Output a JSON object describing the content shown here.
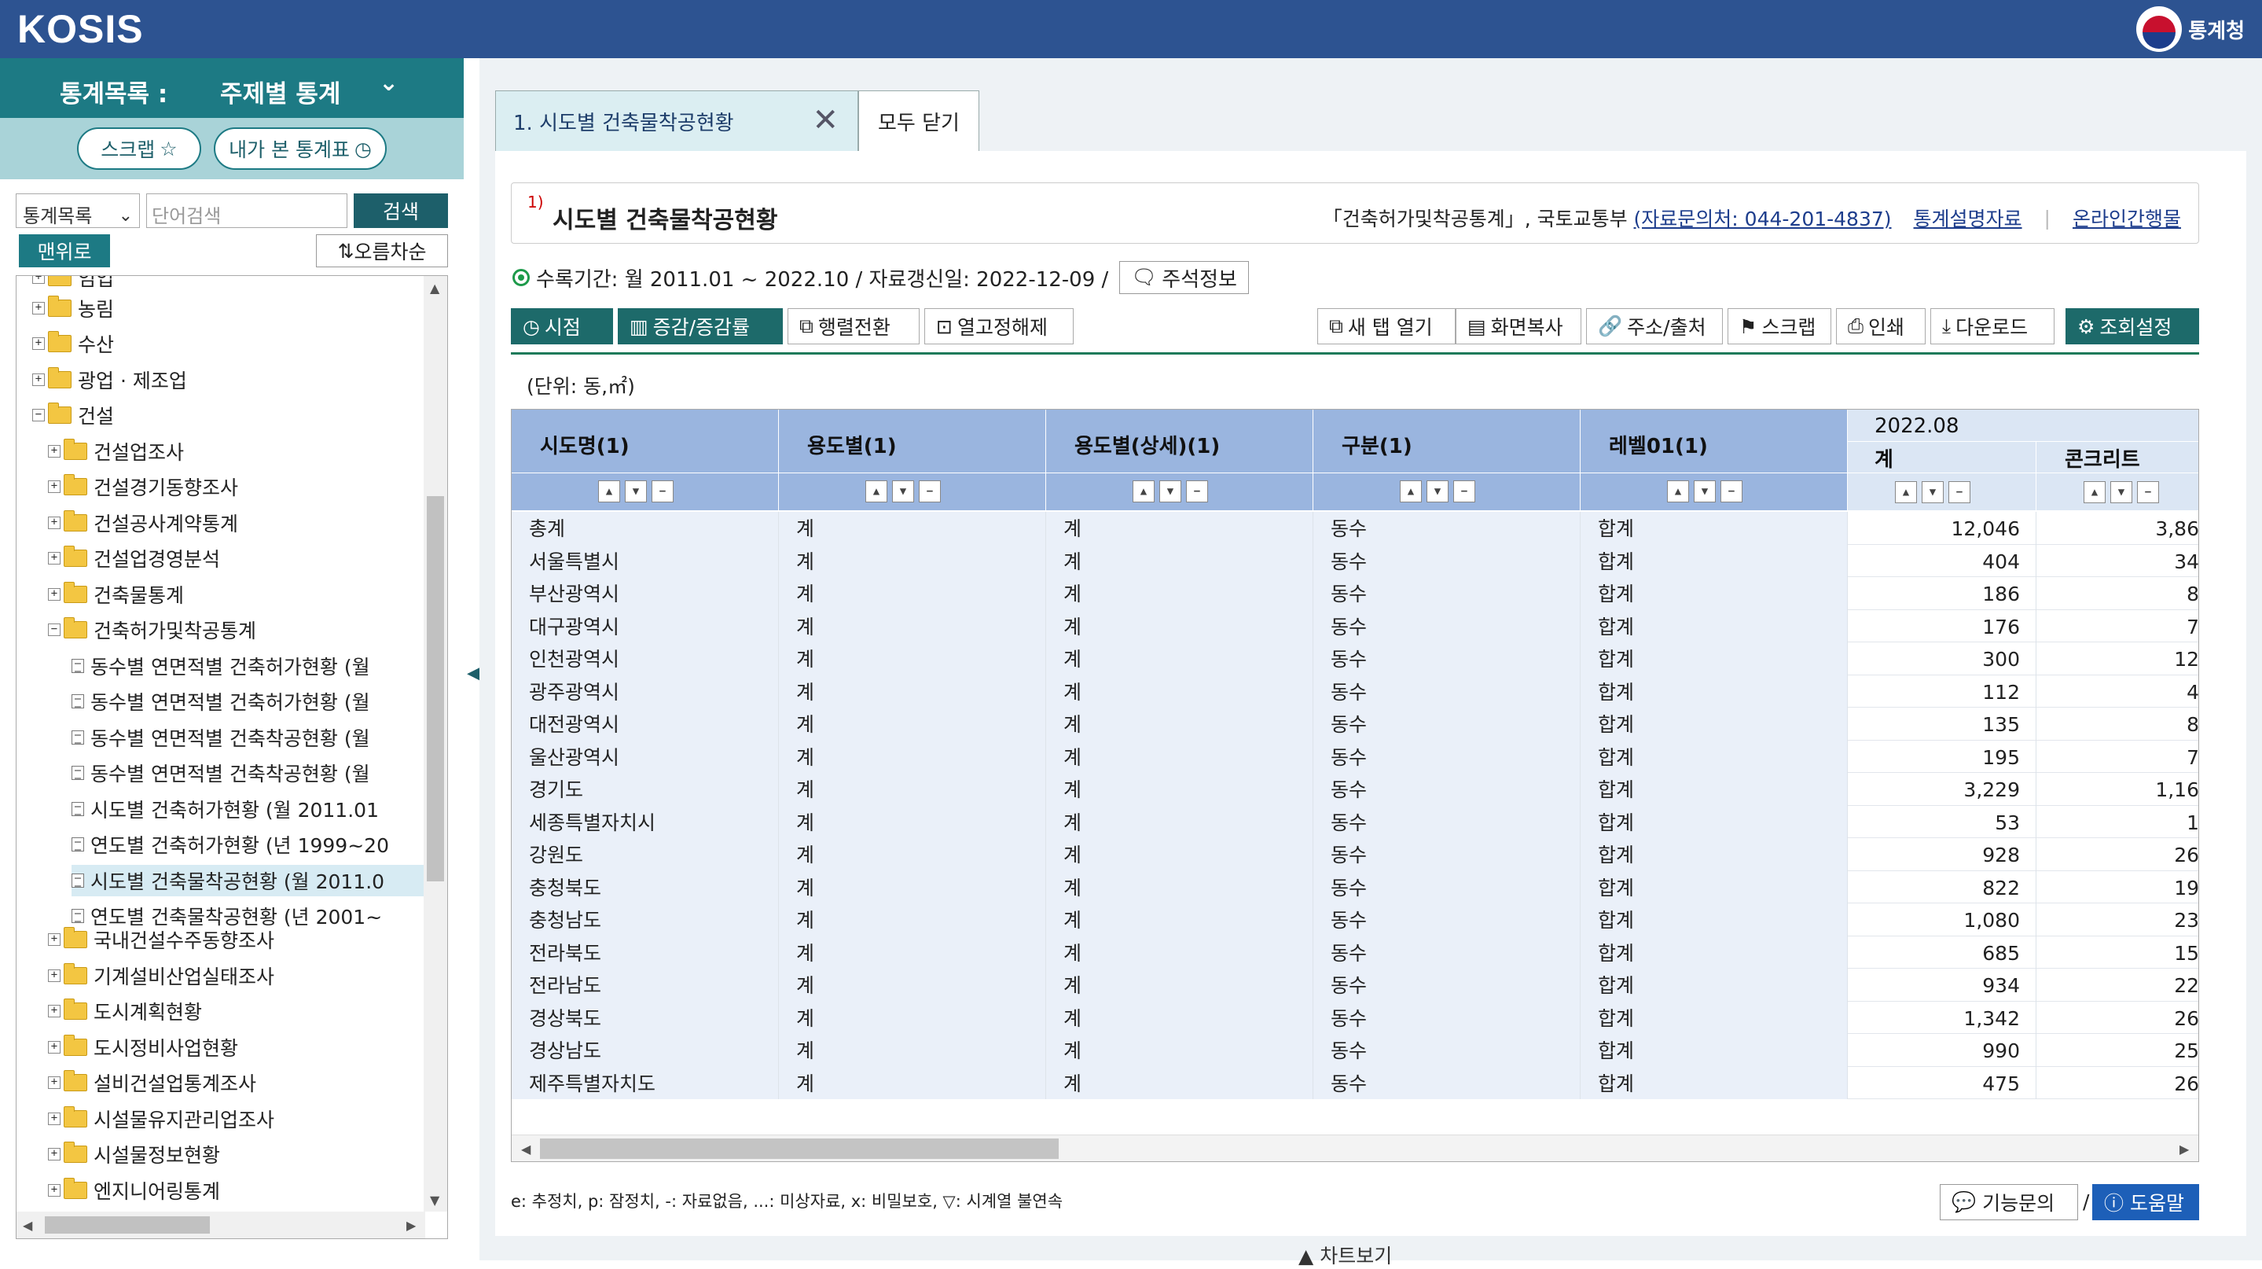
{
  "header": {
    "logo": "KOSIS",
    "agency": "통계청"
  },
  "sidebar": {
    "title": "통계목록 :",
    "mode": "주제별 통계",
    "scrap": "스크랩",
    "my_tables": "내가 본 통계표",
    "search_select": "통계목록",
    "search_placeholder": "단어검색",
    "search_btn": "검색",
    "top_btn": "맨위로",
    "sort_btn": "오름차순",
    "tree": [
      {
        "label": "임업",
        "level": 1,
        "type": "folder",
        "exp": "+"
      },
      {
        "label": "농림",
        "level": 1,
        "type": "folder",
        "exp": "+"
      },
      {
        "label": "수산",
        "level": 1,
        "type": "folder",
        "exp": "+"
      },
      {
        "label": "광업 · 제조업",
        "level": 1,
        "type": "folder",
        "exp": "+"
      },
      {
        "label": "건설",
        "level": 1,
        "type": "folder",
        "exp": "-"
      },
      {
        "label": "건설업조사",
        "level": 2,
        "type": "folder",
        "exp": "+"
      },
      {
        "label": "건설경기동향조사",
        "level": 2,
        "type": "folder",
        "exp": "+"
      },
      {
        "label": "건설공사계약통계",
        "level": 2,
        "type": "folder",
        "exp": "+"
      },
      {
        "label": "건설업경영분석",
        "level": 2,
        "type": "folder",
        "exp": "+"
      },
      {
        "label": "건축물통계",
        "level": 2,
        "type": "folder",
        "exp": "+"
      },
      {
        "label": "건축허가및착공통계",
        "level": 2,
        "type": "folder",
        "exp": "-"
      },
      {
        "label": "동수별 연면적별 건축허가현황 (월",
        "level": 3,
        "type": "doc"
      },
      {
        "label": "동수별 연면적별 건축허가현황 (월",
        "level": 3,
        "type": "doc"
      },
      {
        "label": "동수별 연면적별 건축착공현황 (월",
        "level": 3,
        "type": "doc"
      },
      {
        "label": "동수별 연면적별 건축착공현황 (월",
        "level": 3,
        "type": "doc"
      },
      {
        "label": "시도별 건축허가현황 (월 2011.01",
        "level": 3,
        "type": "doc"
      },
      {
        "label": "연도별 건축허가현황 (년 1999~20",
        "level": 3,
        "type": "doc"
      },
      {
        "label": "시도별 건축물착공현황 (월 2011.0",
        "level": 3,
        "type": "doc",
        "selected": true
      },
      {
        "label": "연도별 건축물착공현황 (년 2001~",
        "level": 3,
        "type": "doc"
      },
      {
        "label": "국내건설수주동향조사",
        "level": 2,
        "type": "folder",
        "exp": "+"
      },
      {
        "label": "기계설비산업실태조사",
        "level": 2,
        "type": "folder",
        "exp": "+"
      },
      {
        "label": "도시계획현황",
        "level": 2,
        "type": "folder",
        "exp": "+"
      },
      {
        "label": "도시정비사업현황",
        "level": 2,
        "type": "folder",
        "exp": "+"
      },
      {
        "label": "설비건설업통계조사",
        "level": 2,
        "type": "folder",
        "exp": "+"
      },
      {
        "label": "시설물유지관리업조사",
        "level": 2,
        "type": "folder",
        "exp": "+"
      },
      {
        "label": "시설물정보현황",
        "level": 2,
        "type": "folder",
        "exp": "+"
      },
      {
        "label": "엔지니어링통계",
        "level": 2,
        "type": "folder",
        "exp": "+"
      }
    ]
  },
  "tabs": {
    "active": "1. 시도별 건축물착공현황",
    "close_all": "모두 닫기"
  },
  "table_title": {
    "sup": "1)",
    "title": "시도별 건축물착공현황",
    "source": "「건축허가및착공통계」, 국토교통부",
    "contact": "(자료문의처: 044-201-4837)",
    "desc": "통계설명자료",
    "online": "온라인간행물"
  },
  "period": {
    "text": "수록기간: 월 2011.01 ~ 2022.10 / 자료갱신일: 2022-12-09 /",
    "note_btn": "주석정보"
  },
  "toolbar": {
    "time": "시점",
    "change": "증감/증감률",
    "pivot": "행렬전환",
    "unfix": "열고정해제",
    "newtab": "새 탭 열기",
    "copy": "화면복사",
    "url": "주소/출처",
    "scrap": "스크랩",
    "print": "인쇄",
    "download": "다운로드",
    "settings": "조회설정"
  },
  "unit": "(단위: 동,㎡)",
  "grid": {
    "headers": [
      "시도명(1)",
      "용도별(1)",
      "용도별(상세)(1)",
      "구분(1)",
      "레벨01(1)"
    ],
    "period": "2022.08",
    "sub_headers": [
      "계",
      "콘크리트"
    ],
    "rows": [
      [
        "총계",
        "계",
        "계",
        "동수",
        "합계",
        "12,046",
        "3,86"
      ],
      [
        "서울특별시",
        "계",
        "계",
        "동수",
        "합계",
        "404",
        "34"
      ],
      [
        "부산광역시",
        "계",
        "계",
        "동수",
        "합계",
        "186",
        "8"
      ],
      [
        "대구광역시",
        "계",
        "계",
        "동수",
        "합계",
        "176",
        "7"
      ],
      [
        "인천광역시",
        "계",
        "계",
        "동수",
        "합계",
        "300",
        "12"
      ],
      [
        "광주광역시",
        "계",
        "계",
        "동수",
        "합계",
        "112",
        "4"
      ],
      [
        "대전광역시",
        "계",
        "계",
        "동수",
        "합계",
        "135",
        "8"
      ],
      [
        "울산광역시",
        "계",
        "계",
        "동수",
        "합계",
        "195",
        "7"
      ],
      [
        "경기도",
        "계",
        "계",
        "동수",
        "합계",
        "3,229",
        "1,16"
      ],
      [
        "세종특별자치시",
        "계",
        "계",
        "동수",
        "합계",
        "53",
        "1"
      ],
      [
        "강원도",
        "계",
        "계",
        "동수",
        "합계",
        "928",
        "26"
      ],
      [
        "충청북도",
        "계",
        "계",
        "동수",
        "합계",
        "822",
        "19"
      ],
      [
        "충청남도",
        "계",
        "계",
        "동수",
        "합계",
        "1,080",
        "23"
      ],
      [
        "전라북도",
        "계",
        "계",
        "동수",
        "합계",
        "685",
        "15"
      ],
      [
        "전라남도",
        "계",
        "계",
        "동수",
        "합계",
        "934",
        "22"
      ],
      [
        "경상북도",
        "계",
        "계",
        "동수",
        "합계",
        "1,342",
        "26"
      ],
      [
        "경상남도",
        "계",
        "계",
        "동수",
        "합계",
        "990",
        "25"
      ],
      [
        "제주특별자치도",
        "계",
        "계",
        "동수",
        "합계",
        "475",
        "26"
      ]
    ]
  },
  "legend": "e: 추정치, p: 잠정치, -: 자료없음, ...: 미상자료, x: 비밀보호, ▽: 시계열 불연속",
  "footer": {
    "inquiry": "기능문의",
    "sep": "/",
    "help": "도움말",
    "chart": "차트보기"
  }
}
